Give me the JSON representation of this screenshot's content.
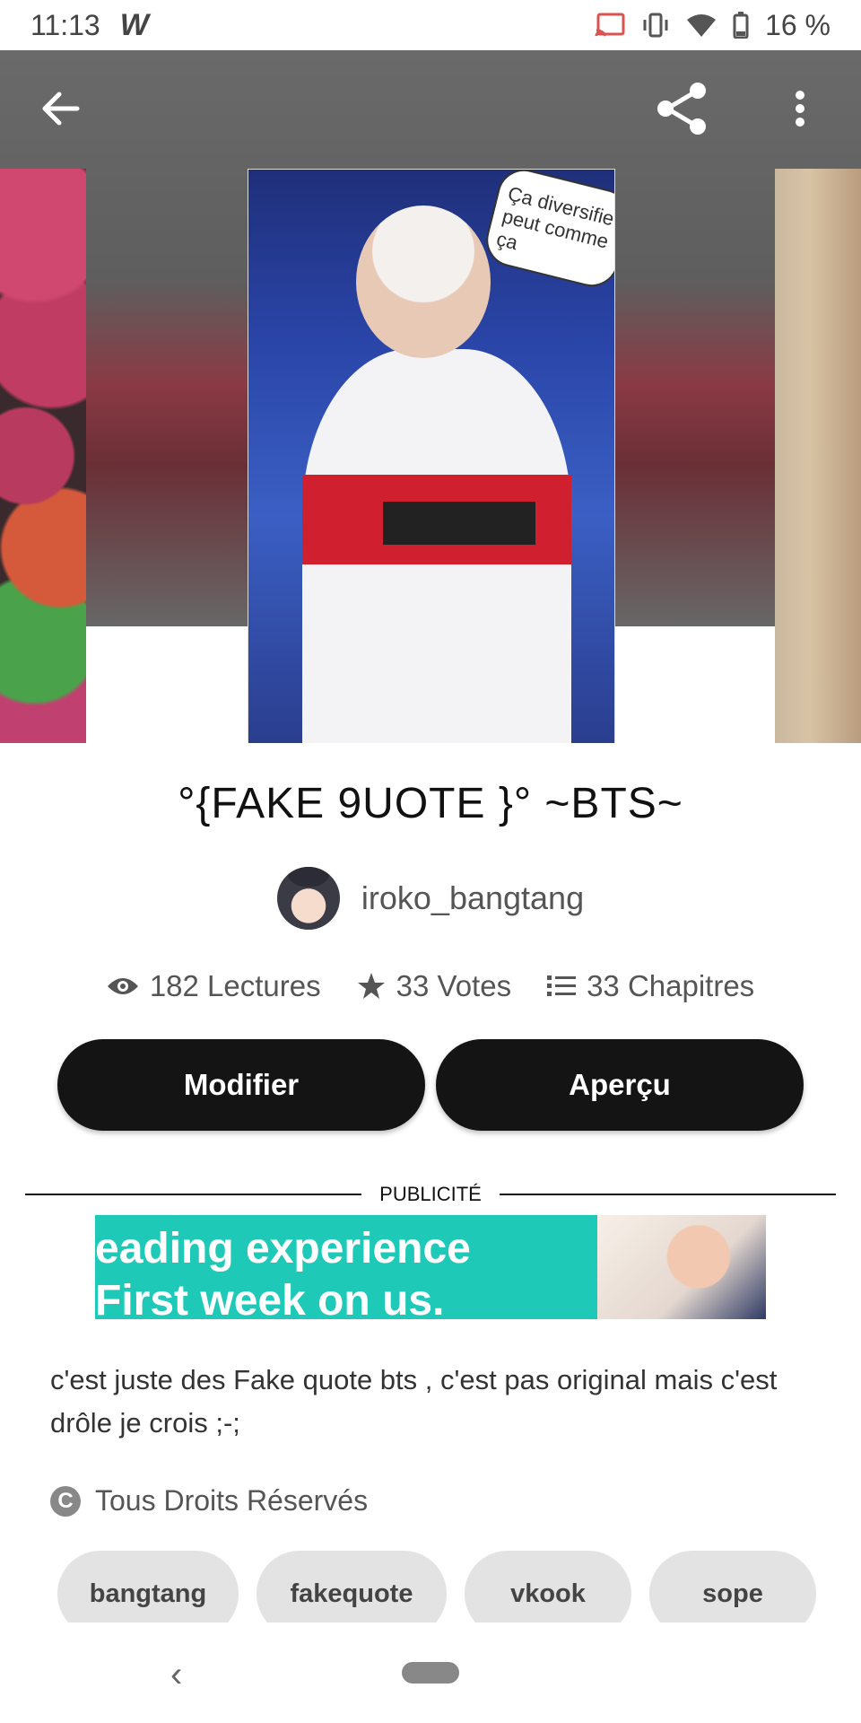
{
  "status_bar": {
    "time": "11:13",
    "app_mark": "W",
    "battery": "16 %"
  },
  "toolbar": {
    "back_icon": "arrow-left-icon",
    "share_icon": "share-icon",
    "more_icon": "more-vert-icon"
  },
  "cover": {
    "bubble_text": "Ça diversifie peut comme ça"
  },
  "story": {
    "title": "°{FAKE 9UOTE }° ~BTS~",
    "author": "iroko_bangtang",
    "stats": [
      {
        "icon": "eye-icon",
        "label": "182 Lectures"
      },
      {
        "icon": "star-icon",
        "label": "33 Votes"
      },
      {
        "icon": "list-icon",
        "label": "33 Chapitres"
      }
    ],
    "buttons": {
      "edit": "Modifier",
      "preview": "Aperçu"
    },
    "description": "c'est juste des Fake quote bts , c'est pas original mais c'est drôle je crois ;-;",
    "rights": "Tous Droits Réservés",
    "tags": [
      "bangtang",
      "fakequote",
      "vkook",
      "sope"
    ]
  },
  "ad": {
    "label": "PUBLICITÉ",
    "line1": "eading experience",
    "line2": "First week on us."
  },
  "nav": {
    "back_glyph": "‹"
  },
  "colors": {
    "button_bg": "#141414",
    "ad_bg": "#1fc9b7",
    "tag_bg": "#e3e3e3"
  }
}
